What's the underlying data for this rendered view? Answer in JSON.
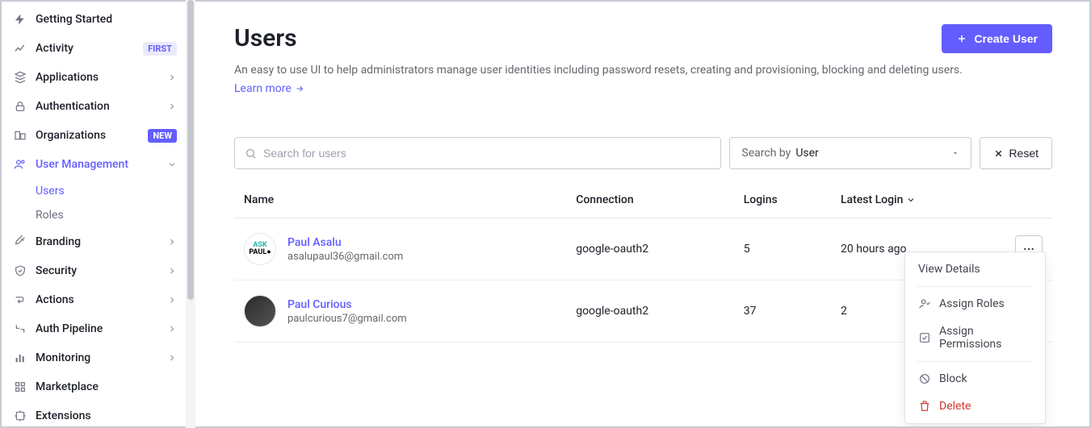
{
  "sidebar": {
    "items": [
      {
        "label": "Getting Started",
        "icon": "bolt",
        "chevron": false
      },
      {
        "label": "Activity",
        "icon": "chart",
        "chevron": false,
        "badge": "FIRST",
        "badgeClass": "badge-first"
      },
      {
        "label": "Applications",
        "icon": "apps",
        "chevron": true
      },
      {
        "label": "Authentication",
        "icon": "lock",
        "chevron": true
      },
      {
        "label": "Organizations",
        "icon": "org",
        "chevron": false,
        "badge": "NEW",
        "badgeClass": "badge-new"
      },
      {
        "label": "User Management",
        "icon": "users",
        "chevron": true,
        "active": true
      },
      {
        "label": "Branding",
        "icon": "brush",
        "chevron": true
      },
      {
        "label": "Security",
        "icon": "shield",
        "chevron": true
      },
      {
        "label": "Actions",
        "icon": "flow",
        "chevron": true
      },
      {
        "label": "Auth Pipeline",
        "icon": "pipeline",
        "chevron": true
      },
      {
        "label": "Monitoring",
        "icon": "bars",
        "chevron": true
      },
      {
        "label": "Marketplace",
        "icon": "market",
        "chevron": false
      },
      {
        "label": "Extensions",
        "icon": "ext",
        "chevron": false
      }
    ],
    "sub": [
      {
        "label": "Users",
        "active": true
      },
      {
        "label": "Roles",
        "active": false
      }
    ]
  },
  "page": {
    "title": "Users",
    "description": "An easy to use UI to help administrators manage user identities including password resets, creating and provisioning, blocking and deleting users.",
    "learn_more": "Learn more",
    "create_button": "Create User"
  },
  "toolbar": {
    "search_placeholder": "Search for users",
    "search_by_label": "Search by",
    "search_by_value": "User",
    "reset_label": "Reset"
  },
  "table": {
    "headers": {
      "name": "Name",
      "connection": "Connection",
      "logins": "Logins",
      "latest_login": "Latest Login"
    },
    "rows": [
      {
        "name": "Paul Asalu",
        "email": "asalupaul36@gmail.com",
        "connection": "google-oauth2",
        "logins": "5",
        "latest_login": "20 hours ago",
        "avatar": "av1"
      },
      {
        "name": "Paul Curious",
        "email": "paulcurious7@gmail.com",
        "connection": "google-oauth2",
        "logins": "37",
        "latest_login": "2",
        "avatar": "av2"
      }
    ]
  },
  "row_menu": {
    "view_details": "View Details",
    "assign_roles": "Assign Roles",
    "assign_permissions": "Assign Permissions",
    "block": "Block",
    "delete": "Delete"
  }
}
